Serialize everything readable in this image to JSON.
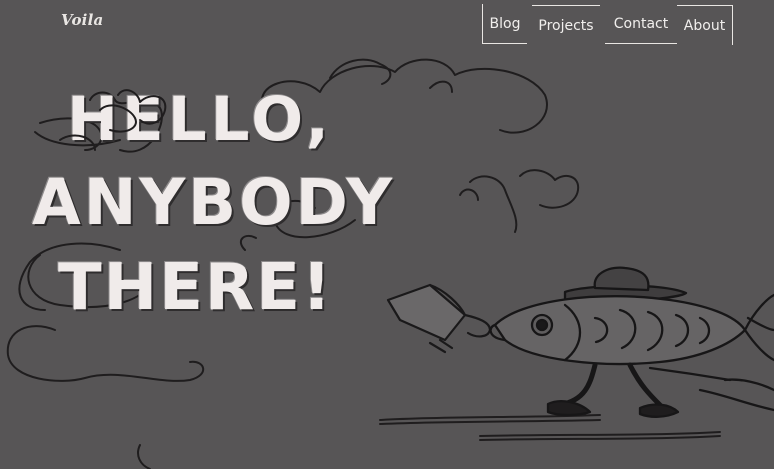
{
  "site": {
    "logo": "Voila"
  },
  "nav": {
    "items": [
      {
        "label": "Blog"
      },
      {
        "label": "Projects"
      },
      {
        "label": "Contact"
      },
      {
        "label": "About"
      }
    ]
  },
  "hero": {
    "line1": "HELLO,",
    "line2": "ANYBODY",
    "line3": "THERE!"
  },
  "colors": {
    "background": "#575556",
    "text": "#f0ebea",
    "ink": "#1f1d1e"
  },
  "illustration": {
    "icons": [
      "fish-icon",
      "megaphone-icon",
      "cloud-doodle-icon",
      "wings-icon"
    ]
  }
}
